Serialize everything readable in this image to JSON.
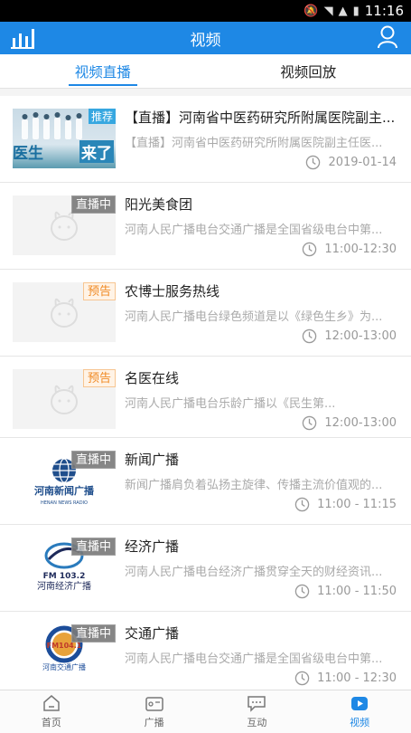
{
  "status_bar": {
    "time": "11:16"
  },
  "app_bar": {
    "title": "视频"
  },
  "tabs": [
    {
      "label": "视频直播",
      "active": true
    },
    {
      "label": "视频回放",
      "active": false
    }
  ],
  "items": [
    {
      "thumb": "doctor",
      "badge": "",
      "thumb_tag": "推荐",
      "thumb_text1": "医生",
      "thumb_text2": "来了",
      "title": "【直播】河南省中医药研究所附属医院副主...",
      "desc": "【直播】河南省中医药研究所附属医院副主任医...",
      "time": "2019-01-14"
    },
    {
      "thumb": "placeholder",
      "badge": "直播中",
      "badge_type": "live",
      "title": "阳光美食团",
      "desc": "河南人民广播电台交通广播是全国省级电台中第...",
      "time": "11:00-12:30"
    },
    {
      "thumb": "placeholder",
      "badge": "预告",
      "badge_type": "preview",
      "title": "农博士服务热线",
      "desc": "河南人民广播电台绿色频道是以《绿色生乡》为...",
      "time": "12:00-13:00"
    },
    {
      "thumb": "placeholder",
      "badge": "预告",
      "badge_type": "preview",
      "title": "名医在线",
      "desc": "河南人民广播电台乐龄广播以《民生第...",
      "time": "12:00-13:00"
    },
    {
      "thumb": "news",
      "badge": "直播中",
      "badge_type": "live",
      "logo_text": "河南新闻广播",
      "logo_sub": "HENAN NEWS RADIO",
      "title": "新闻广播",
      "desc": "新闻广播肩负着弘扬主旋律、传播主流价值观的...",
      "time": "11:00 - 11:15"
    },
    {
      "thumb": "economy",
      "badge": "直播中",
      "badge_type": "live",
      "logo_text": "FM 103.2",
      "logo_sub": "河南经济广播",
      "title": "经济广播",
      "desc": "河南人民广播电台经济广播贯穿全天的财经资讯...",
      "time": "11:00 - 11:50"
    },
    {
      "thumb": "traffic",
      "badge": "直播中",
      "badge_type": "live",
      "logo_text": "FM104.1",
      "logo_sub": "河南交通广播",
      "title": "交通广播",
      "desc": "河南人民广播电台交通广播是全国省级电台中第...",
      "time": "11:00 - 12:30"
    }
  ],
  "bottom_nav": [
    {
      "label": "首页",
      "icon": "home-icon",
      "active": false
    },
    {
      "label": "广播",
      "icon": "radio-icon",
      "active": false
    },
    {
      "label": "互动",
      "icon": "chat-icon",
      "active": false
    },
    {
      "label": "视频",
      "icon": "video-icon",
      "active": true
    }
  ],
  "colors": {
    "accent": "#1e88e5",
    "preview": "#f08a24"
  }
}
